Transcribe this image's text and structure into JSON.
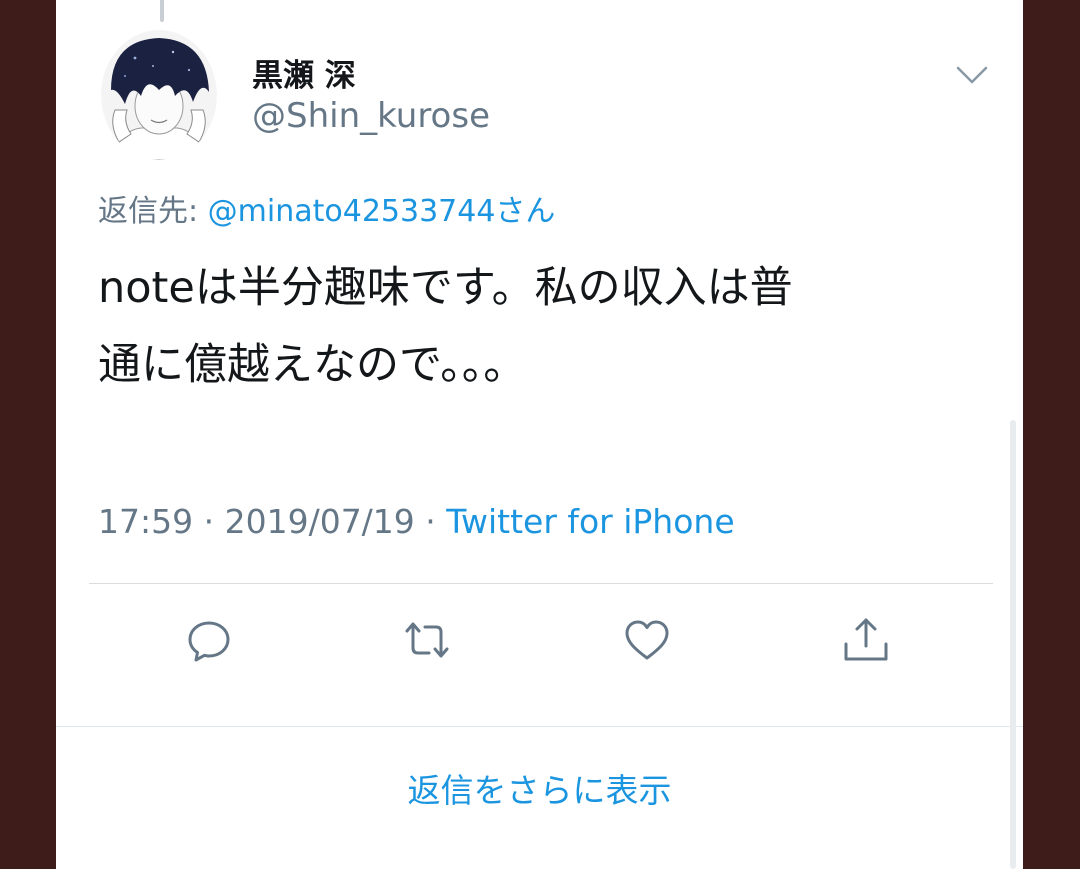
{
  "tweet": {
    "display_name": "黒瀬 深",
    "handle": "@Shin_kurose",
    "reply_prefix": "返信先: ",
    "reply_mention": "@minato42533744さん",
    "text_line1": "noteは半分趣味です。私の収入は普",
    "text_line2": "通に億越えなので。。。",
    "time": "17:59",
    "separator1": " · ",
    "date": "2019/07/19",
    "separator2": " · ",
    "source": "Twitter for iPhone"
  },
  "actions": {
    "reply_icon": "reply-icon",
    "retweet_icon": "retweet-icon",
    "like_icon": "heart-icon",
    "share_icon": "share-icon"
  },
  "footer": {
    "show_more_replies": "返信をさらに表示"
  },
  "colors": {
    "accent": "#1b95e0",
    "secondary_text": "#657786",
    "primary_text": "#14171a",
    "backdrop": "#3e1c1a"
  }
}
